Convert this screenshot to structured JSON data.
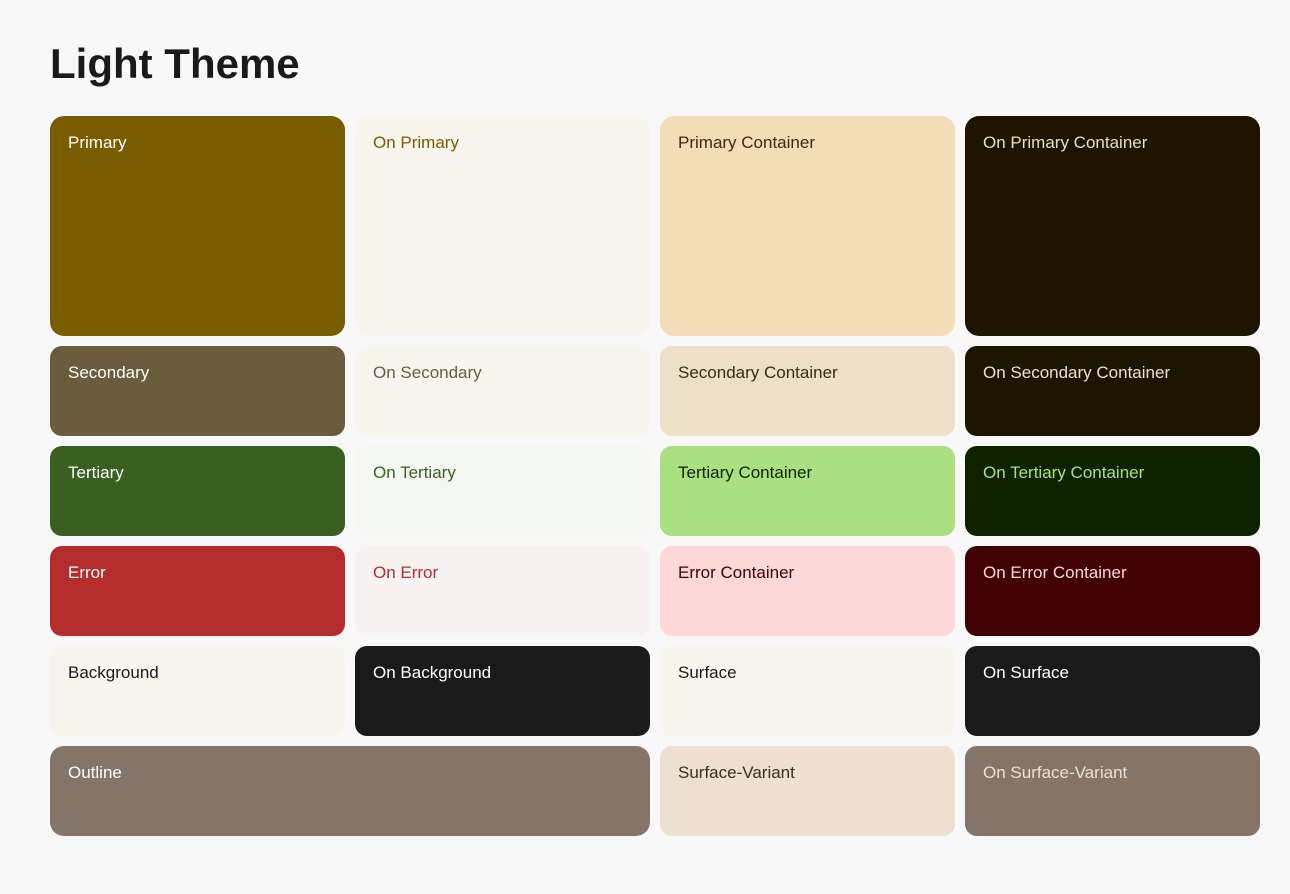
{
  "title": "Light Theme",
  "rows": {
    "primary_row": {
      "cells": [
        {
          "key": "primary",
          "label": "Primary"
        },
        {
          "key": "on-primary",
          "label": "On Primary"
        },
        {
          "key": "primary-container",
          "label": "Primary Container"
        },
        {
          "key": "on-primary-container",
          "label": "On Primary Container"
        }
      ]
    },
    "secondary_row": {
      "cells": [
        {
          "key": "secondary",
          "label": "Secondary"
        },
        {
          "key": "on-secondary",
          "label": "On Secondary"
        },
        {
          "key": "secondary-container",
          "label": "Secondary Container"
        },
        {
          "key": "on-secondary-container",
          "label": "On Secondary Container"
        }
      ]
    },
    "tertiary_row": {
      "cells": [
        {
          "key": "tertiary",
          "label": "Tertiary"
        },
        {
          "key": "on-tertiary",
          "label": "On Tertiary"
        },
        {
          "key": "tertiary-container",
          "label": "Tertiary Container"
        },
        {
          "key": "on-tertiary-container",
          "label": "On Tertiary Container"
        }
      ]
    },
    "error_row": {
      "cells": [
        {
          "key": "error",
          "label": "Error"
        },
        {
          "key": "on-error",
          "label": "On Error"
        },
        {
          "key": "error-container",
          "label": "Error Container"
        },
        {
          "key": "on-error-container",
          "label": "On Error Container"
        }
      ]
    },
    "background_row": {
      "cells": [
        {
          "key": "background",
          "label": "Background"
        },
        {
          "key": "on-background",
          "label": "On Background"
        },
        {
          "key": "surface",
          "label": "Surface"
        },
        {
          "key": "on-surface",
          "label": "On Surface"
        }
      ]
    },
    "outline_row": {
      "cells": [
        {
          "key": "outline",
          "label": "Outline"
        },
        {
          "key": "surface-variant",
          "label": "Surface-Variant"
        },
        {
          "key": "on-surface-variant",
          "label": "On Surface-Variant"
        }
      ]
    }
  }
}
